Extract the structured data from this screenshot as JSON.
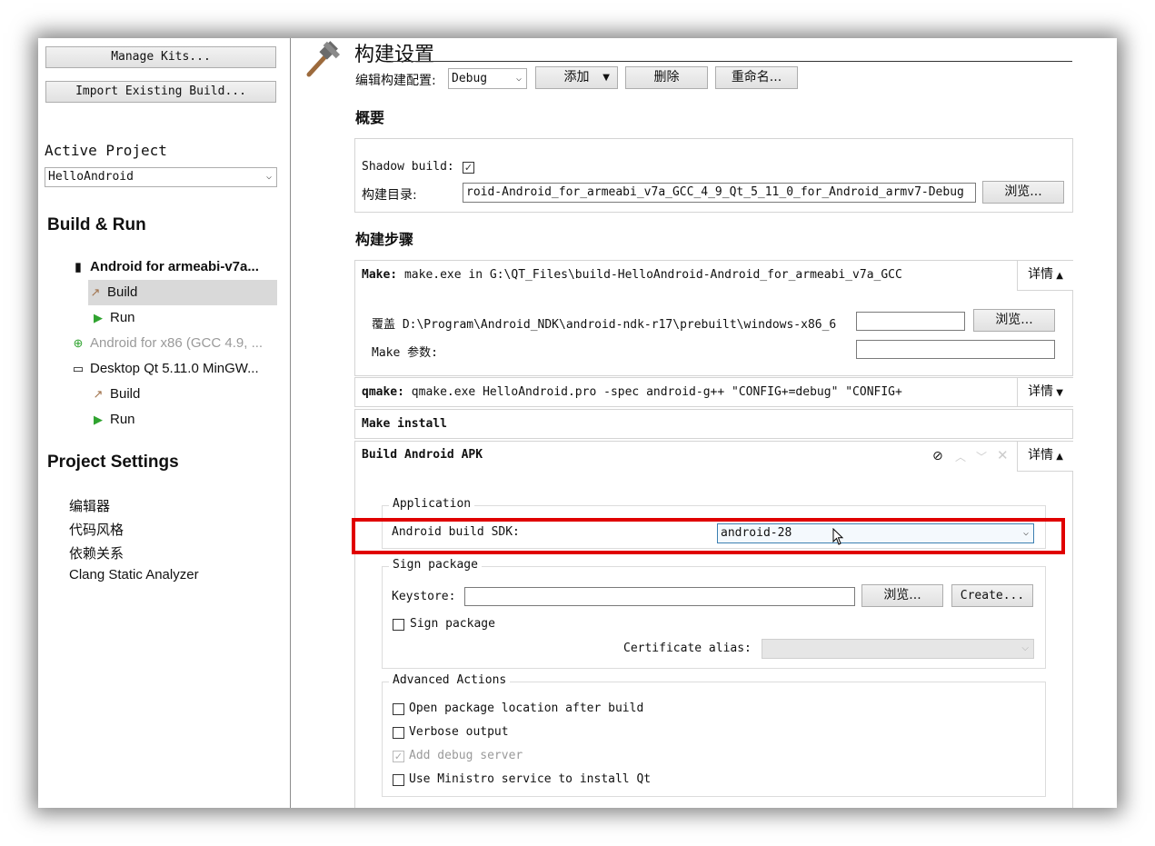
{
  "sidebar": {
    "manage_kits": "Manage Kits...",
    "import_build": "Import Existing Build...",
    "active_project_label": "Active Project",
    "active_project_value": "HelloAndroid",
    "build_run_title": "Build & Run",
    "kits": [
      {
        "name": "Android for armeabi-v7a...",
        "build": "Build",
        "run": "Run"
      },
      {
        "name": "Android for x86 (GCC 4.9, ..."
      },
      {
        "name": "Desktop Qt 5.11.0 MinGW...",
        "build": "Build",
        "run": "Run"
      }
    ],
    "project_settings_title": "Project Settings",
    "settings_items": [
      "编辑器",
      "代码风格",
      "依赖关系",
      "Clang Static Analyzer"
    ]
  },
  "header": {
    "title": "构建设置",
    "edit_config_label": "编辑构建配置:",
    "config_value": "Debug",
    "add_button": "添加",
    "delete_button": "删除",
    "rename_button": "重命名..."
  },
  "overview": {
    "title": "概要",
    "shadow_build_label": "Shadow build:",
    "build_dir_label": "构建目录:",
    "build_dir_value": "roid-Android_for_armeabi_v7a_GCC_4_9_Qt_5_11_0_for_Android_armv7-Debug",
    "browse_button": "浏览..."
  },
  "steps": {
    "title": "构建步骤",
    "make_label": "Make:",
    "make_text": "make.exe in G:\\QT_Files\\build-HelloAndroid-Android_for_armeabi_v7a_GCC",
    "details": "详情",
    "override_label": "覆盖 D:\\Program\\Android_NDK\\android-ndk-r17\\prebuilt\\windows-x86_6",
    "browse_button": "浏览...",
    "make_args_label": "Make 参数:",
    "qmake_label": "qmake:",
    "qmake_text": "qmake.exe HelloAndroid.pro -spec android-g++ \"CONFIG+=debug\" \"CONFIG+",
    "make_install": "Make install",
    "apk_title": "Build Android APK"
  },
  "apk": {
    "application_legend": "Application",
    "sdk_label": "Android build SDK:",
    "sdk_value": "android-28",
    "sign_legend": "Sign package",
    "keystore_label": "Keystore:",
    "browse_button": "浏览...",
    "create_button": "Create...",
    "sign_package_label": "Sign package",
    "cert_alias_label": "Certificate alias:",
    "advanced_legend": "Advanced Actions",
    "open_location": "Open package location after build",
    "verbose": "Verbose output",
    "debug_server": "Add debug server",
    "ministro": "Use Ministro service to install Qt"
  },
  "colors": {
    "highlight": "#e00000",
    "run_green": "#2fa32f"
  }
}
